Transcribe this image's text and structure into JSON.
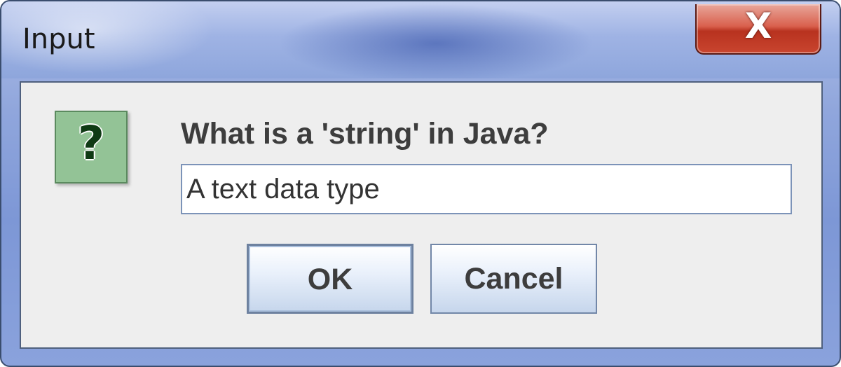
{
  "window": {
    "title": "Input",
    "close_glyph": "X"
  },
  "dialog": {
    "icon": "question-icon",
    "icon_glyph": "?",
    "prompt": "What is a 'string' in Java?",
    "input_value": "A text data type"
  },
  "buttons": {
    "ok_label": "OK",
    "cancel_label": "Cancel"
  },
  "colors": {
    "titlebar": "#8ea6dc",
    "close_button": "#c9452f",
    "client_bg": "#eeeeee",
    "icon_bg": "#93c396"
  }
}
